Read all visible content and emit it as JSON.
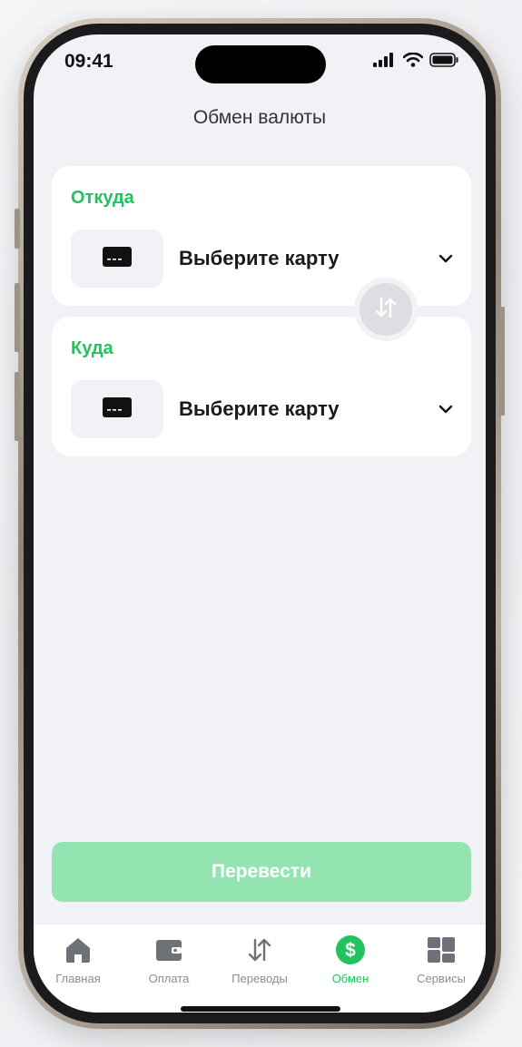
{
  "status_bar": {
    "time": "09:41"
  },
  "header": {
    "title": "Обмен валюты"
  },
  "from_card": {
    "label": "Откуда",
    "value": "Выберите карту"
  },
  "to_card": {
    "label": "Куда",
    "value": "Выберите карту"
  },
  "actions": {
    "submit_label": "Перевести"
  },
  "tabbar": {
    "items": [
      {
        "label": "Главная",
        "icon": "home-icon"
      },
      {
        "label": "Оплата",
        "icon": "wallet-icon"
      },
      {
        "label": "Переводы",
        "icon": "transfer-arrows-icon"
      },
      {
        "label": "Обмен",
        "icon": "dollar-circle-icon",
        "active": true
      },
      {
        "label": "Сервисы",
        "icon": "grid-icon"
      }
    ]
  },
  "colors": {
    "accent": "#22c35f",
    "button_disabled": "#93e4b1",
    "background": "#f0f2f5"
  }
}
